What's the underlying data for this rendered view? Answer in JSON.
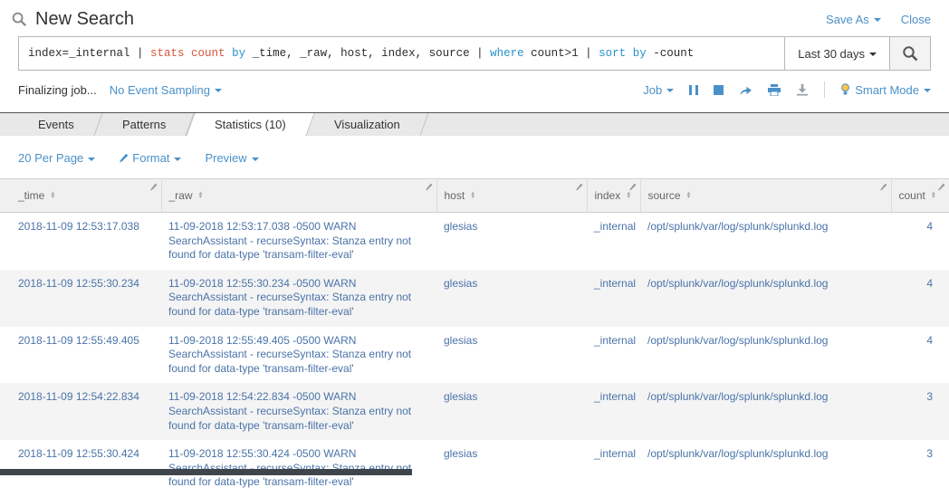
{
  "header": {
    "title": "New Search",
    "save_as": "Save As",
    "close": "Close"
  },
  "search": {
    "query_segments": [
      {
        "t": "index=_internal | ",
        "c": "plain"
      },
      {
        "t": "stats count",
        "c": "command"
      },
      {
        "t": " ",
        "c": "plain"
      },
      {
        "t": "by",
        "c": "keyword"
      },
      {
        "t": " _time, _raw, host, index, source | ",
        "c": "plain"
      },
      {
        "t": "where",
        "c": "keyword"
      },
      {
        "t": " count>1 | ",
        "c": "plain"
      },
      {
        "t": "sort",
        "c": "keyword"
      },
      {
        "t": " ",
        "c": "plain"
      },
      {
        "t": "by",
        "c": "keyword"
      },
      {
        "t": " -count",
        "c": "plain"
      }
    ],
    "time_range": "Last 30 days"
  },
  "status": {
    "job_status": "Finalizing job...",
    "sampling": "No Event Sampling",
    "job_menu": "Job",
    "smart_mode": "Smart Mode"
  },
  "tabs": [
    {
      "id": "events",
      "label": "Events",
      "active": false
    },
    {
      "id": "patterns",
      "label": "Patterns",
      "active": false
    },
    {
      "id": "statistics",
      "label": "Statistics (10)",
      "active": true
    },
    {
      "id": "visualization",
      "label": "Visualization",
      "active": false
    }
  ],
  "toolbar": {
    "per_page": "20 Per Page",
    "format": "Format",
    "preview": "Preview"
  },
  "table": {
    "columns": [
      {
        "id": "_time",
        "label": "_time"
      },
      {
        "id": "_raw",
        "label": "_raw"
      },
      {
        "id": "host",
        "label": "host"
      },
      {
        "id": "index",
        "label": "index"
      },
      {
        "id": "source",
        "label": "source"
      },
      {
        "id": "count",
        "label": "count"
      }
    ],
    "rows": [
      {
        "time": "2018-11-09 12:53:17.038",
        "raw": "11-09-2018 12:53:17.038 -0500 WARN SearchAssistant - recurseSyntax: Stanza entry not found for data-type 'transam-filter-eval'",
        "host": "glesias",
        "index": "_internal",
        "source": "/opt/splunk/var/log/splunk/splunkd.log",
        "count": "4"
      },
      {
        "time": "2018-11-09 12:55:30.234",
        "raw": "11-09-2018 12:55:30.234 -0500 WARN SearchAssistant - recurseSyntax: Stanza entry not found for data-type 'transam-filter-eval'",
        "host": "glesias",
        "index": "_internal",
        "source": "/opt/splunk/var/log/splunk/splunkd.log",
        "count": "4"
      },
      {
        "time": "2018-11-09 12:55:49.405",
        "raw": "11-09-2018 12:55:49.405 -0500 WARN SearchAssistant - recurseSyntax: Stanza entry not found for data-type 'transam-filter-eval'",
        "host": "glesias",
        "index": "_internal",
        "source": "/opt/splunk/var/log/splunk/splunkd.log",
        "count": "4"
      },
      {
        "time": "2018-11-09 12:54:22.834",
        "raw": "11-09-2018 12:54:22.834 -0500 WARN SearchAssistant - recurseSyntax: Stanza entry not found for data-type 'transam-filter-eval'",
        "host": "glesias",
        "index": "_internal",
        "source": "/opt/splunk/var/log/splunk/splunkd.log",
        "count": "3"
      },
      {
        "time": "2018-11-09 12:55:30.424",
        "raw": "11-09-2018 12:55:30.424 -0500 WARN SearchAssistant - recurseSyntax: Stanza entry not found for data-type 'transam-filter-eval'",
        "host": "glesias",
        "index": "_internal",
        "source": "/opt/splunk/var/log/splunk/splunkd.log",
        "count": "3"
      }
    ]
  },
  "colors": {
    "link_blue": "#4a90c9",
    "cell_link_blue": "#4a73a8",
    "query_command_red": "#d6563c",
    "query_keyword_blue": "#2a92c9",
    "tab_bar_gray": "#e8e8e8",
    "header_gray": "#f0f0f0"
  }
}
